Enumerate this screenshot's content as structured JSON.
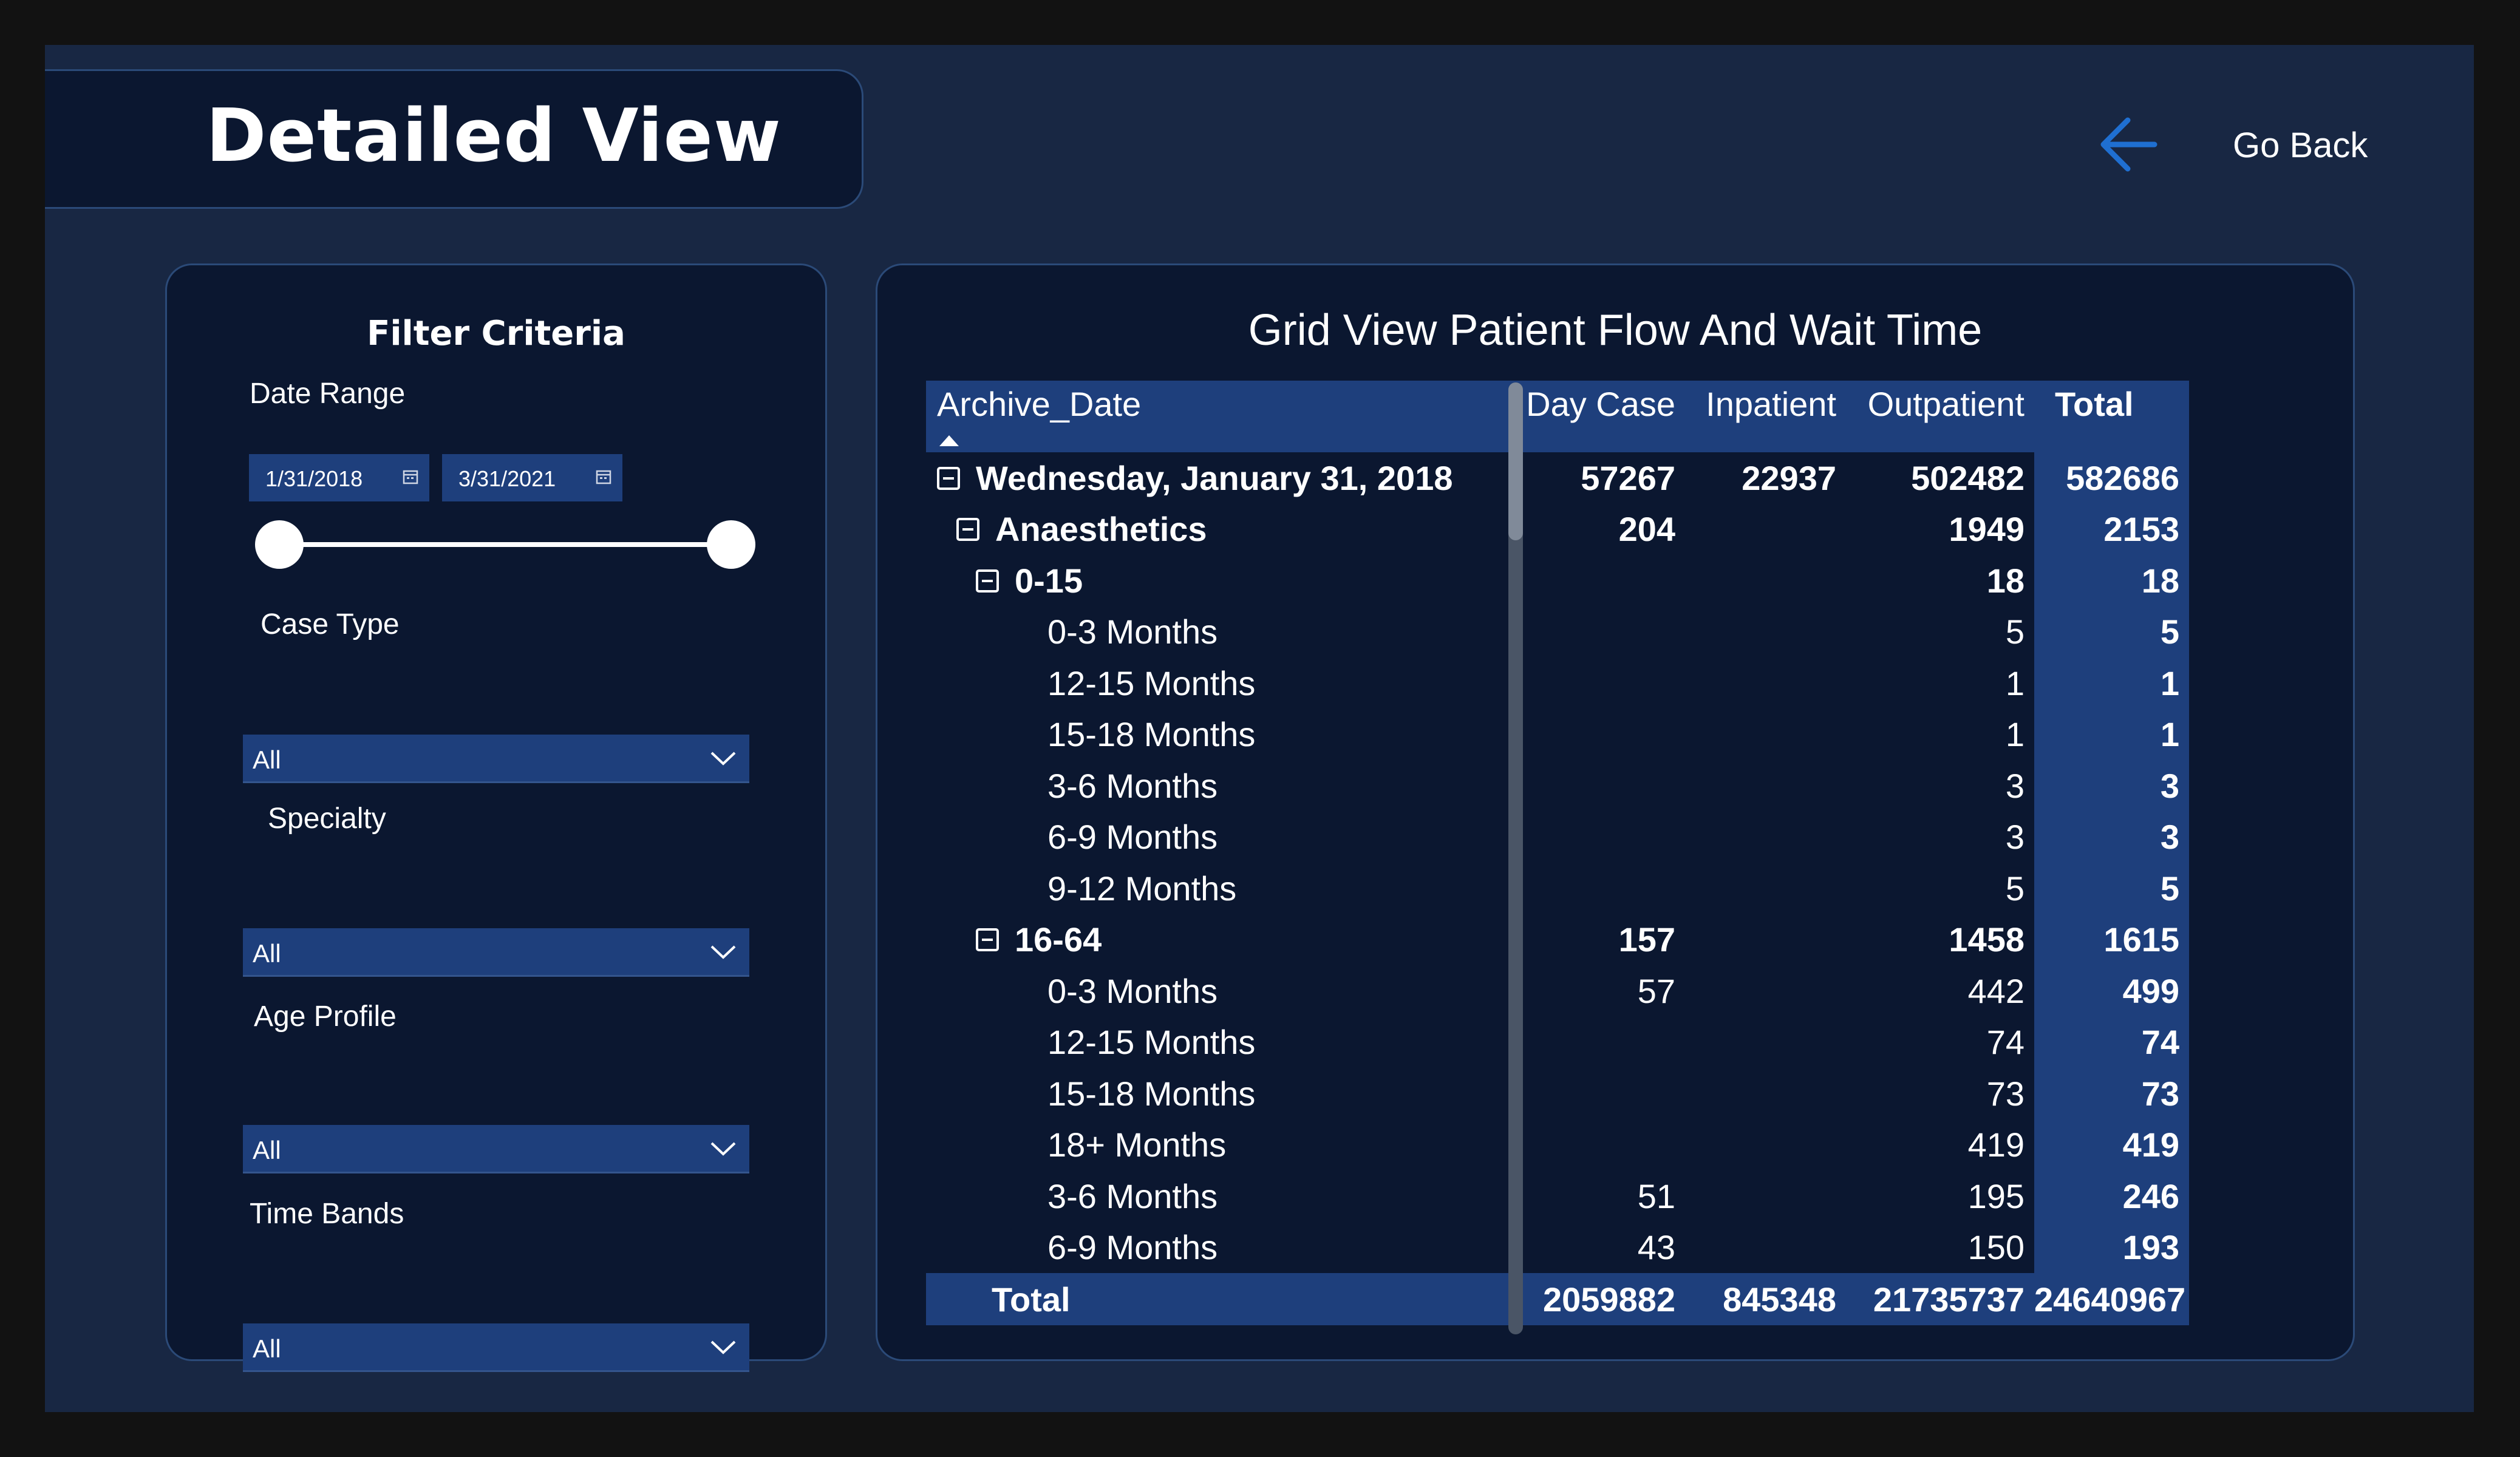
{
  "header": {
    "title": "Detailed View",
    "go_back_label": "Go Back"
  },
  "filters": {
    "title": "Filter Criteria",
    "date_range_label": "Date Range",
    "date_start": "1/31/2018",
    "date_end": "3/31/2021",
    "case_type_label": "Case Type",
    "case_type_value": "All",
    "specialty_label": "Specialty",
    "specialty_value": "All",
    "age_profile_label": "Age Profile",
    "age_profile_value": "All",
    "time_bands_label": "Time Bands",
    "time_bands_value": "All"
  },
  "grid": {
    "title": "Grid View Patient Flow And Wait Time",
    "columns": [
      "Archive_Date",
      "Day Case",
      "Inpatient",
      "Outpatient",
      "Total"
    ],
    "rows": [
      {
        "level": 1,
        "label": "Wednesday, January 31, 2018",
        "day_case": "57267",
        "inpatient": "22937",
        "outpatient": "502482",
        "total": "582686"
      },
      {
        "level": 2,
        "label": "Anaesthetics",
        "day_case": "204",
        "inpatient": "",
        "outpatient": "1949",
        "total": "2153"
      },
      {
        "level": 3,
        "label": "0-15",
        "day_case": "",
        "inpatient": "",
        "outpatient": "18",
        "total": "18"
      },
      {
        "level": 4,
        "label": "0-3 Months",
        "day_case": "",
        "inpatient": "",
        "outpatient": "5",
        "total": "5"
      },
      {
        "level": 4,
        "label": "12-15 Months",
        "day_case": "",
        "inpatient": "",
        "outpatient": "1",
        "total": "1"
      },
      {
        "level": 4,
        "label": "15-18 Months",
        "day_case": "",
        "inpatient": "",
        "outpatient": "1",
        "total": "1"
      },
      {
        "level": 4,
        "label": "3-6 Months",
        "day_case": "",
        "inpatient": "",
        "outpatient": "3",
        "total": "3"
      },
      {
        "level": 4,
        "label": "6-9 Months",
        "day_case": "",
        "inpatient": "",
        "outpatient": "3",
        "total": "3"
      },
      {
        "level": 4,
        "label": "9-12 Months",
        "day_case": "",
        "inpatient": "",
        "outpatient": "5",
        "total": "5"
      },
      {
        "level": 3,
        "label": "16-64",
        "day_case": "157",
        "inpatient": "",
        "outpatient": "1458",
        "total": "1615"
      },
      {
        "level": 4,
        "label": "0-3 Months",
        "day_case": "57",
        "inpatient": "",
        "outpatient": "442",
        "total": "499"
      },
      {
        "level": 4,
        "label": "12-15 Months",
        "day_case": "",
        "inpatient": "",
        "outpatient": "74",
        "total": "74"
      },
      {
        "level": 4,
        "label": "15-18 Months",
        "day_case": "",
        "inpatient": "",
        "outpatient": "73",
        "total": "73"
      },
      {
        "level": 4,
        "label": "18+ Months",
        "day_case": "",
        "inpatient": "",
        "outpatient": "419",
        "total": "419"
      },
      {
        "level": 4,
        "label": "3-6 Months",
        "day_case": "51",
        "inpatient": "",
        "outpatient": "195",
        "total": "246"
      },
      {
        "level": 4,
        "label": "6-9 Months",
        "day_case": "43",
        "inpatient": "",
        "outpatient": "150",
        "total": "193"
      }
    ],
    "total_row": {
      "label": "Total",
      "day_case": "2059882",
      "inpatient": "845348",
      "outpatient": "21735737",
      "total": "24640967"
    }
  },
  "colors": {
    "background": "#182743",
    "panel": "#0b1730",
    "accent": "#1e3f7c",
    "arrow": "#1f6fd1"
  },
  "icons": {
    "back": "arrow-left-icon",
    "calendar": "calendar-icon",
    "dropdown": "chevron-down-icon",
    "collapse": "collapse-minus-icon",
    "sort": "sort-ascending-icon"
  }
}
